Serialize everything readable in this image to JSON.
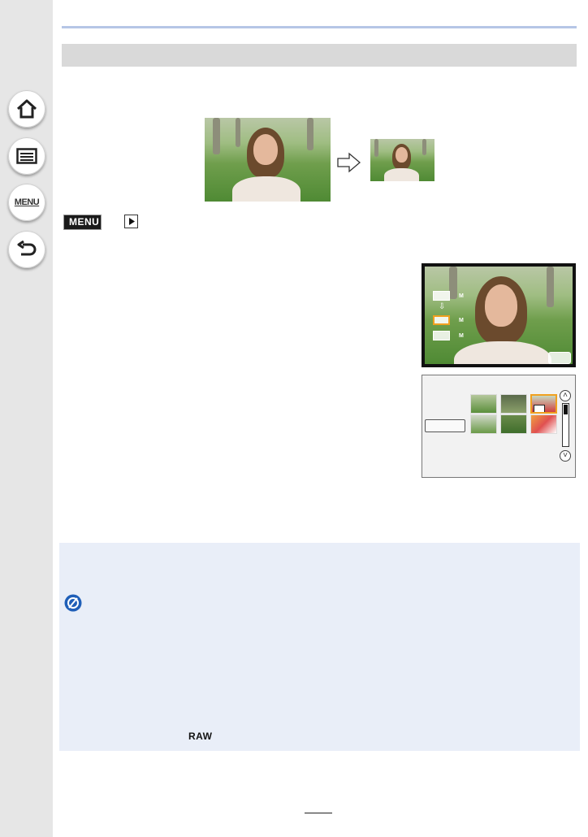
{
  "sidebar": {
    "items": [
      {
        "name": "home-icon"
      },
      {
        "name": "contents-list-icon"
      },
      {
        "name": "menu-icon",
        "label": "MENU"
      },
      {
        "name": "back-icon"
      }
    ]
  },
  "menu_path": {
    "badge": "MENU",
    "icon": "playback-icon"
  },
  "raw_label": "RAW",
  "page_number": "",
  "colors": {
    "sidebar": "#e6e6e6",
    "notes_background": "#e9eef8",
    "highlight": "#f0a020",
    "header_rule": "#b6c6e6"
  }
}
